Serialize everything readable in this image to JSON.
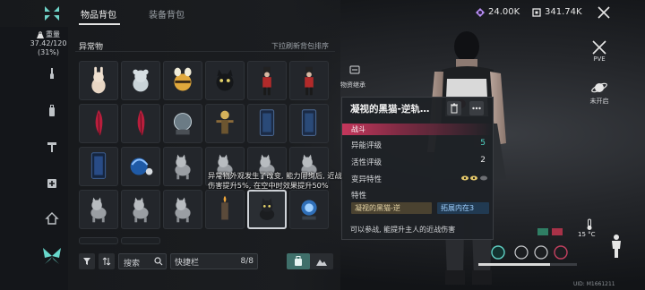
{
  "topbar": {
    "tabs": [
      {
        "label": "物品背包",
        "active": true
      },
      {
        "label": "装备背包",
        "active": false
      }
    ],
    "currencies": [
      {
        "icon": "crystal-icon",
        "value": "24.00K",
        "color": "#b58cf0"
      },
      {
        "icon": "coin-icon",
        "value": "341.74K",
        "color": "#e8e8e8"
      }
    ]
  },
  "weight": {
    "label": "重量",
    "value": "37.42/120",
    "percent": "(31%)"
  },
  "rail_icons": [
    "wrench-icon",
    "backpack-icon",
    "tool-icon",
    "first-aid-icon",
    "home-icon",
    "butterfly-icon"
  ],
  "category": {
    "title": "异常物",
    "sort_hint": "下拉刷新背包排序"
  },
  "grid": {
    "items": [
      "rabbit-plush-icon",
      "bear-plush-icon",
      "bee-plush-icon",
      "black-cat-plush-icon",
      "soldier-figure-icon",
      "soldier-figure-icon",
      "red-feather-icon",
      "red-feather-icon",
      "snow-globe-icon",
      "scarecrow-icon",
      "mirror-icon",
      "mirror-icon",
      "blue-mirror-icon",
      "blue-ball-icon",
      "cat-figure-icon",
      "cat-figure-icon",
      "cat-figure-icon",
      "cat-figure-icon",
      "cat-figure-icon",
      "cat-figure-icon",
      "cat-figure-icon",
      "candle-icon",
      "black-cat-figure-icon",
      "blue-orb-icon"
    ],
    "selected_index": 22
  },
  "toolbar": {
    "search_label": "搜索",
    "quickbar_label": "快捷栏",
    "quickbar_count": "8/8"
  },
  "side_tooltip": {
    "label": "物资继承"
  },
  "detail": {
    "title": "凝视的黑猫-逆轨…",
    "tag": "战斗",
    "rows": [
      {
        "label": "异能评级",
        "value": "5",
        "color": "#4fd3c4"
      },
      {
        "label": "活性评级",
        "value": "2",
        "color": "#e6e6e6"
      },
      {
        "label": "变异特性",
        "value": "",
        "color": "#e6e6e6"
      }
    ],
    "traits_label": "特性",
    "chips": [
      {
        "text": "凝视的黑猫-逆",
        "bg": "#4a4230",
        "fg": "#e8d7a8"
      },
      {
        "text": "拓展内在3",
        "bg": "#213a52",
        "fg": "#9fd0ff"
      }
    ],
    "description": "可以参战, 能提升主人的近战伤害"
  },
  "tooltip": {
    "text": "异常物外观发生了改变, 能力同步后, 近战伤害提升5%, 在空中时效果提升50%"
  },
  "right": {
    "pve_label": "PVE",
    "planet_label": "未开启",
    "temp": "15 °C",
    "uid": "UID: M1661211"
  }
}
